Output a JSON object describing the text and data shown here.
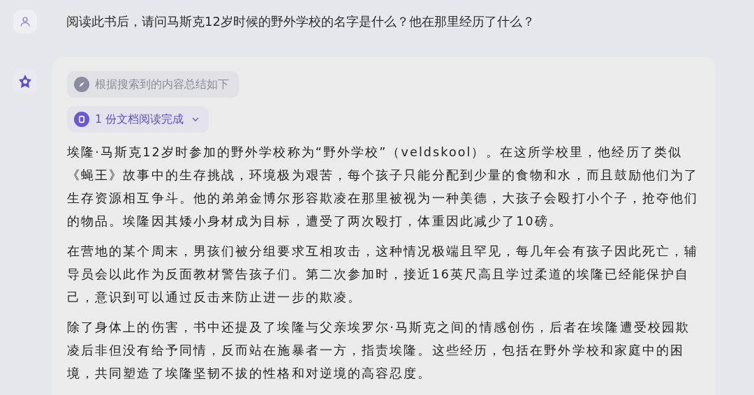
{
  "question": "阅读此书后，请问马斯克12岁时候的野外学校的名字是什么？他在那里经历了什么？",
  "answer": {
    "search_note": "根据搜索到的内容总结如下",
    "documents": "1 份文档阅读完成",
    "paragraphs": [
      "埃隆·马斯克12岁时参加的野外学校称为“野外学校”（veldskool）。在这所学校里，他经历了类似《蝇王》故事中的生存挑战，环境极为艰苦，每个孩子只能分配到少量的食物和水，而且鼓励他们为了生存资源相互争斗。他的弟弟金博尔形容欺凌在那里被视为一种美德，大孩子会殴打小个子，抢夺他们的物品。埃隆因其矮小身材成为目标，遭受了两次殴打，体重因此减少了10磅。",
      "在营地的某个周末，男孩们被分组要求互相攻击，这种情况极端且罕见，每几年会有孩子因此死亡，辅导员会以此作为反面教材警告孩子们。第二次参加时，接近16英尺高且学过柔道的埃隆已经能保护自己，意识到可以通过反击来防止进一步的欺凌。",
      "除了身体上的伤害，书中还提及了埃隆与父亲埃罗尔·马斯克之间的情感创伤，后者在埃隆遭受校园欺凌后非但没有给予同情，反而站在施暴者一方，指责埃隆。这些经历，包括在野外学校和家庭中的困境，共同塑造了埃隆坚韧不拔的性格和对逆境的高容忍度。"
    ]
  }
}
